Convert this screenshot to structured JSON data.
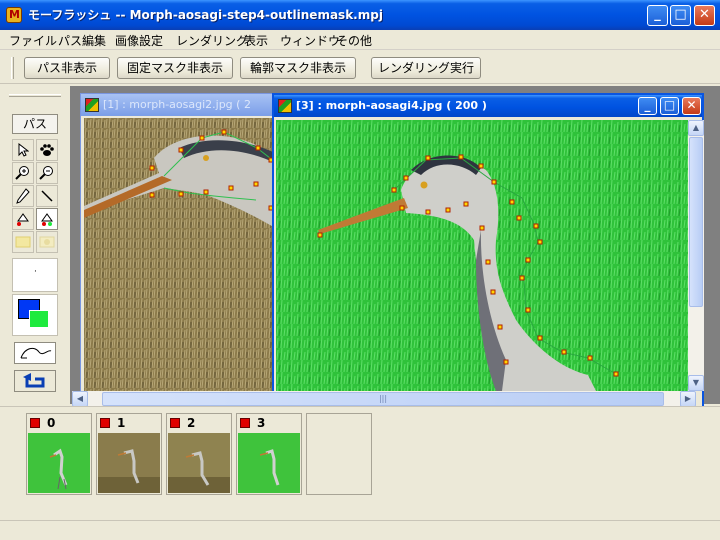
{
  "window": {
    "title": "モーフラッシュ -- Morph-aosagi-step4-outlinemask.mpj",
    "minimize": "_",
    "maximize": "□",
    "close": "✕"
  },
  "menu": [
    "ファイル",
    "パス編集",
    "画像設定",
    "レンダリング",
    "表示",
    "ウィンドウ",
    "その他"
  ],
  "toolbar": {
    "hide_path": "パス非表示",
    "hide_fixed_mask": "固定マスク非表示",
    "hide_outline_mask": "輪郭マスク非表示",
    "render_run": "レンダリング実行"
  },
  "palette": {
    "path_label": "パス",
    "dot": "·",
    "tools": [
      "arrow-icon",
      "paw-icon",
      "zoom-in-icon",
      "zoom-out-icon",
      "pencil-icon",
      "line-icon",
      "fill-add-icon",
      "fill-remove-icon",
      "mask-a-icon",
      "mask-b-icon"
    ],
    "foreground_color": "#0038f5",
    "background_color": "#1eea3e"
  },
  "child_windows": [
    {
      "title": "[1] : morph-aosagi2.jpg ( 2",
      "active": false
    },
    {
      "title": "[3] : morph-aosagi4.jpg ( 200 )",
      "active": true
    }
  ],
  "scroll": {
    "thumb_grip": "|||"
  },
  "frames": [
    {
      "number": "0",
      "scene": "green"
    },
    {
      "number": "1",
      "scene": "dry-grass"
    },
    {
      "number": "2",
      "scene": "dry-grass"
    },
    {
      "number": "3",
      "scene": "green"
    }
  ],
  "colors": {
    "accent": "#0053e1",
    "mask_green": "#2cc43a",
    "path_point": "#ffd800"
  }
}
